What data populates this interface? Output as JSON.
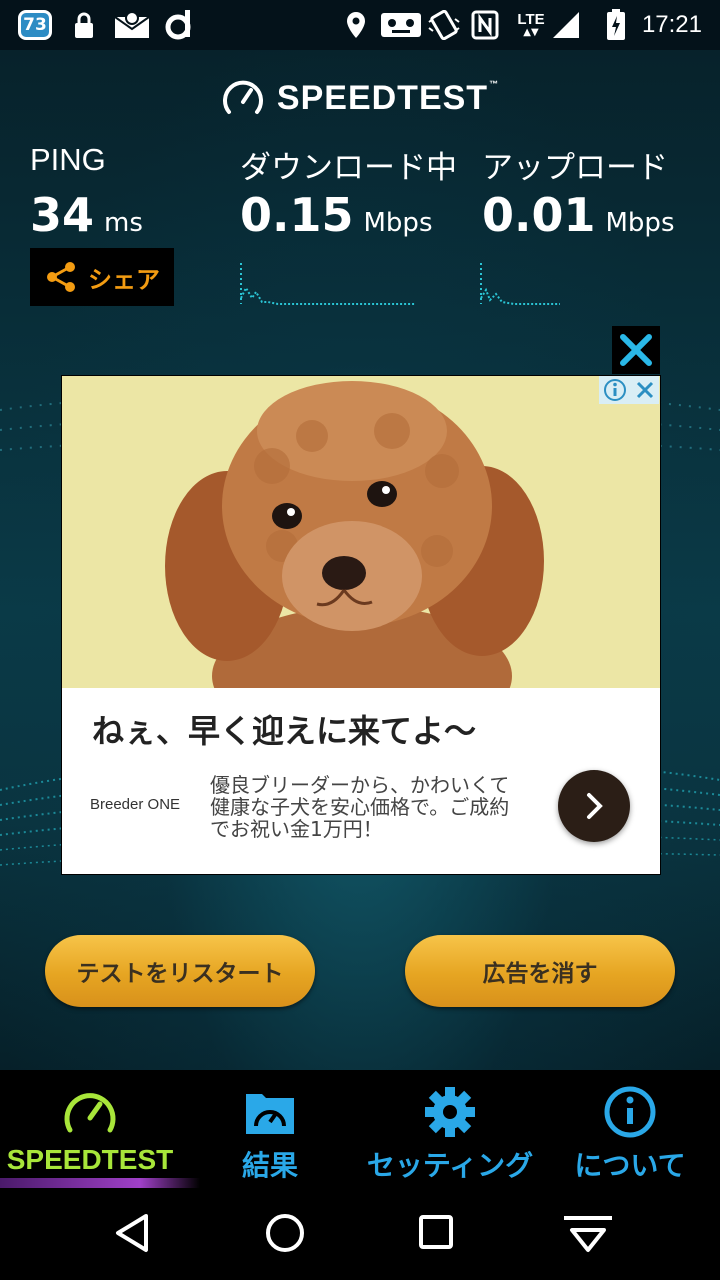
{
  "status_bar": {
    "notification_count": "73",
    "network": "LTE",
    "time": "17:21",
    "left_icons": [
      "badge-icon",
      "lock-icon",
      "mail-icon",
      "d-app-icon"
    ],
    "right_icons": [
      "location-icon",
      "voicemail-icon",
      "vibrate-icon",
      "nfc-icon",
      "lte-icon",
      "signal-icon",
      "battery-charging-icon"
    ]
  },
  "header": {
    "logo_text": "SPEEDTEST",
    "logo_tm": "™"
  },
  "metrics": {
    "ping": {
      "label": "PING",
      "value": "34",
      "unit": "ms"
    },
    "download": {
      "label": "ダウンロード中",
      "value": "0.15",
      "unit": "Mbps"
    },
    "upload": {
      "label": "アップロード",
      "value": "0.01",
      "unit": "Mbps"
    }
  },
  "share": {
    "label": "シェア"
  },
  "ad": {
    "headline": "ねぇ、早く迎えに来てよ〜",
    "brand": "Breeder ONE",
    "body": "優良ブリーダーから、かわいくて\n健康な子犬を安心価格で。ご成約\nでお祝い金1万円！",
    "icons": [
      "ad-close-icon",
      "adchoices-info-icon",
      "ad-dismiss-icon",
      "chevron-right-icon"
    ]
  },
  "buttons": {
    "restart": "テストをリスタート",
    "remove_ads": "広告を消す"
  },
  "tabs": [
    {
      "label": "SPEEDTEST",
      "icon": "speedometer-icon",
      "color": "#a8e63a",
      "active": true
    },
    {
      "label": "結果",
      "icon": "results-folder-icon",
      "color": "#2aa8e8",
      "active": false
    },
    {
      "label": "セッティング",
      "icon": "gear-icon",
      "color": "#2aa8e8",
      "active": false
    },
    {
      "label": "について",
      "icon": "info-icon",
      "color": "#2aa8e8",
      "active": false
    }
  ],
  "colors": {
    "accent_orange": "#f39c12",
    "active_green": "#a8e63a",
    "tab_blue": "#2aa8e8",
    "button_gold": "#e6a522"
  }
}
